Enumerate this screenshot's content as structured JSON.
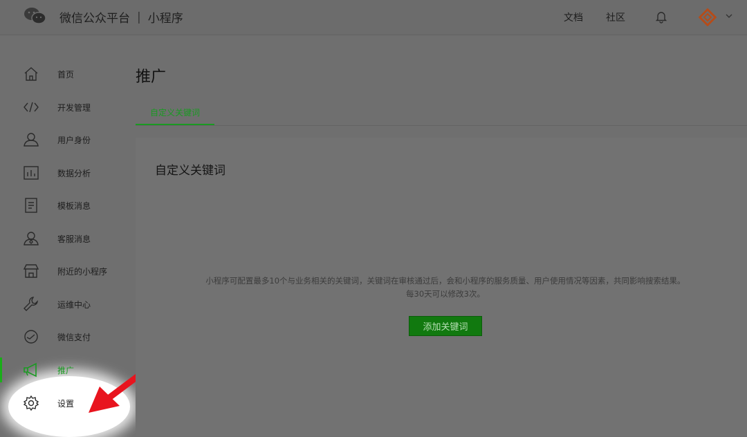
{
  "header": {
    "brand": "微信公众平台",
    "separator": "|",
    "product": "小程序",
    "links": [
      "文档",
      "社区"
    ],
    "icons": [
      "wechat-logo-icon",
      "bell-icon",
      "avatar-icon",
      "chevron-down-icon"
    ]
  },
  "sidebar": {
    "items": [
      {
        "label": "首页",
        "icon": "home-icon"
      },
      {
        "label": "开发管理",
        "icon": "code-icon"
      },
      {
        "label": "用户身份",
        "icon": "user-icon"
      },
      {
        "label": "数据分析",
        "icon": "bar-chart-icon"
      },
      {
        "label": "模板消息",
        "icon": "document-icon"
      },
      {
        "label": "客服消息",
        "icon": "service-user-icon"
      },
      {
        "label": "附近的小程序",
        "icon": "store-icon"
      },
      {
        "label": "运维中心",
        "icon": "wrench-icon"
      },
      {
        "label": "微信支付",
        "icon": "pay-icon"
      },
      {
        "label": "推广",
        "icon": "megaphone-icon",
        "active": true
      },
      {
        "label": "设置",
        "icon": "gear-icon"
      }
    ]
  },
  "main": {
    "title": "推广",
    "tabs": [
      {
        "label": "自定义关键词",
        "active": true
      }
    ],
    "panel": {
      "title": "自定义关键词",
      "desc_line1": "小程序可配置最多10个与业务相关的关键词，关键词在审核通过后，会和小程序的服务质量、用户使用情况等因素，共同影响搜索结果。",
      "desc_line2": "每30天可以修改3次。",
      "add_button": "添加关键词"
    }
  },
  "colors": {
    "accent": "#1aad19",
    "arrow": "#e8141e"
  }
}
